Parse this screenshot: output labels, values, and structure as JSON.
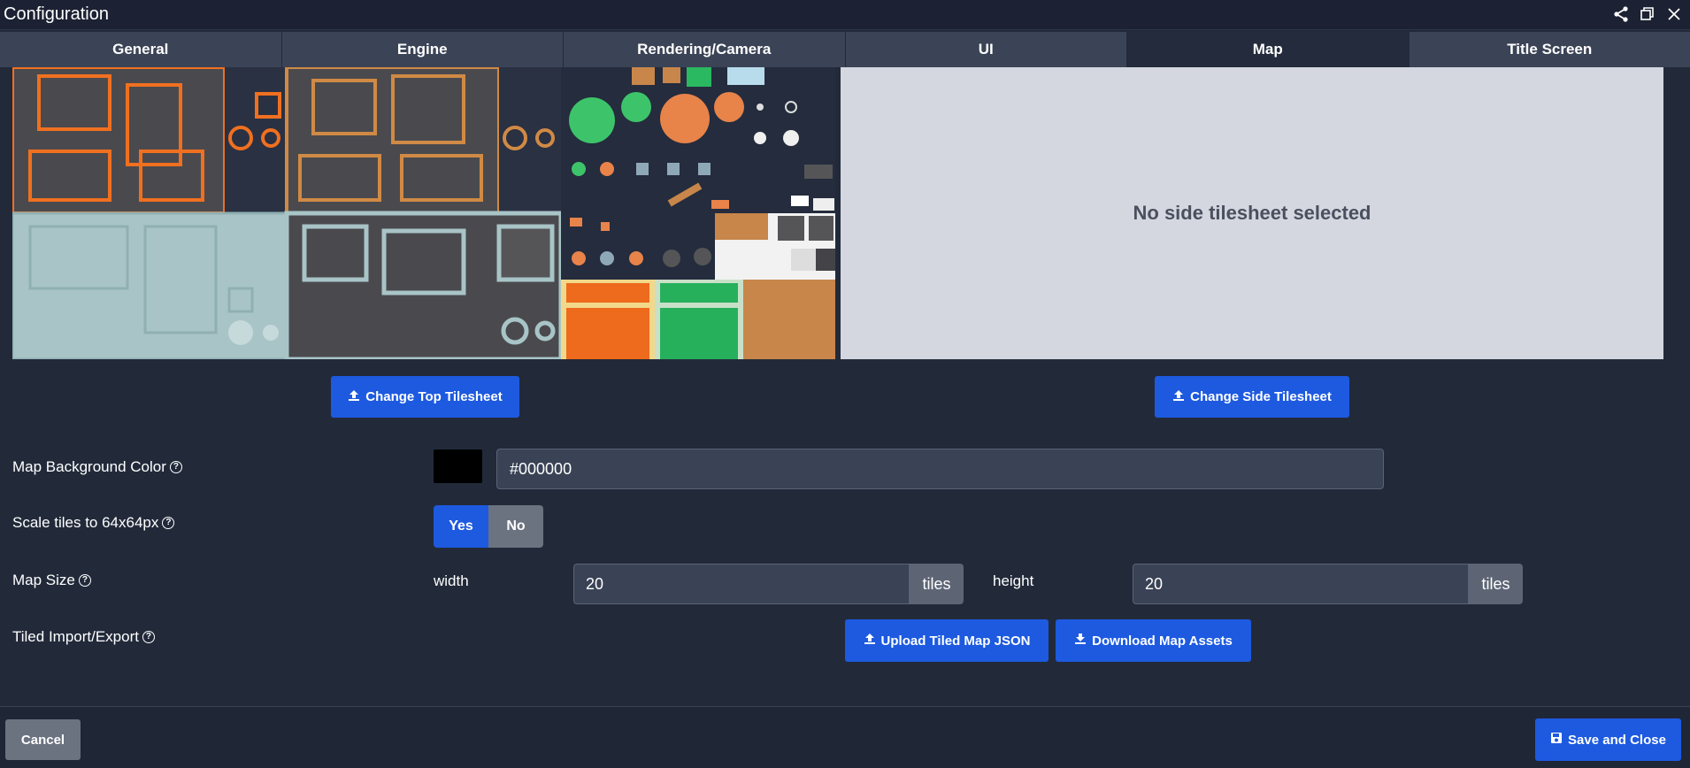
{
  "window": {
    "title": "Configuration"
  },
  "tabs": [
    {
      "label": "General"
    },
    {
      "label": "Engine"
    },
    {
      "label": "Rendering/Camera"
    },
    {
      "label": "UI"
    },
    {
      "label": "Map"
    },
    {
      "label": "Title Screen"
    }
  ],
  "tilesheets": {
    "side_empty_message": "No side tilesheet selected",
    "change_top_label": "Change Top Tilesheet",
    "change_side_label": "Change Side Tilesheet"
  },
  "map_background": {
    "label": "Map Background Color",
    "value": "#000000",
    "swatch_color": "#000000"
  },
  "scale_tiles": {
    "label": "Scale tiles to 64x64px",
    "yes_label": "Yes",
    "no_label": "No",
    "selected": "Yes"
  },
  "map_size": {
    "label": "Map Size",
    "width_label": "width",
    "width_value": "20",
    "height_label": "height",
    "height_value": "20",
    "unit": "tiles"
  },
  "tiled": {
    "label": "Tiled Import/Export",
    "upload_label": "Upload Tiled Map JSON",
    "download_label": "Download Map Assets"
  },
  "footer": {
    "cancel_label": "Cancel",
    "save_label": "Save and Close"
  },
  "colors": {
    "accent": "#1d5ae0",
    "background": "#222a3a",
    "input_bg": "#3a4255"
  }
}
